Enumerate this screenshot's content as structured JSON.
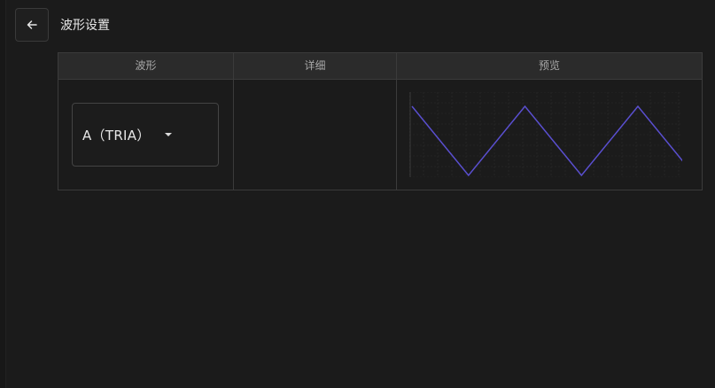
{
  "header": {
    "title": "波形设置",
    "back_icon": "arrow-left-icon"
  },
  "table": {
    "columns": [
      {
        "key": "waveform",
        "label": "波形"
      },
      {
        "key": "detail",
        "label": "详细"
      },
      {
        "key": "preview",
        "label": "预览"
      }
    ]
  },
  "waveform_select": {
    "value": "A（TRIA）",
    "icon": "caret-down-icon"
  },
  "preview": {
    "wave_type": "triangle",
    "line_color": "#5a4fd0",
    "grid_color": "#2c2c2c",
    "axis_color": "#3a3a3a"
  },
  "colors": {
    "background": "#1b1b1b",
    "header_bg": "#2b2b2b",
    "border": "#3b3b3b",
    "text": "#e8e8e8"
  }
}
